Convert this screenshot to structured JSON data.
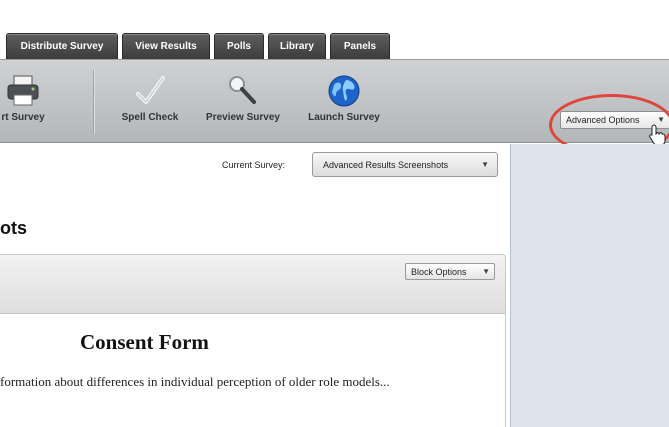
{
  "tabs": [
    "Distribute Survey",
    "View Results",
    "Polls",
    "Library",
    "Panels"
  ],
  "toolbar": {
    "print_label": "rt Survey",
    "spellcheck_label": "Spell Check",
    "preview_label": "Preview Survey",
    "launch_label": "Launch Survey",
    "advanced_label": "Advanced Options",
    "icons": [
      "printer-icon",
      "checkmark-icon",
      "magnifier-icon",
      "globe-icon"
    ]
  },
  "current_survey": {
    "label": "Current Survey:",
    "value": "Advanced Results Screenshots"
  },
  "survey_title": "ots",
  "block": {
    "options_label": "Block Options",
    "consent_title": "Consent Form",
    "consent_text": "formation about differences in individual perception of older role models..."
  },
  "colors": {
    "tab_bg": "#4a4a4a",
    "toolbar_bg": "#c2c5c8",
    "highlight_circle": "#e0453b",
    "side_panel": "#dde4ee",
    "globe_blue": "#1d63c8"
  }
}
